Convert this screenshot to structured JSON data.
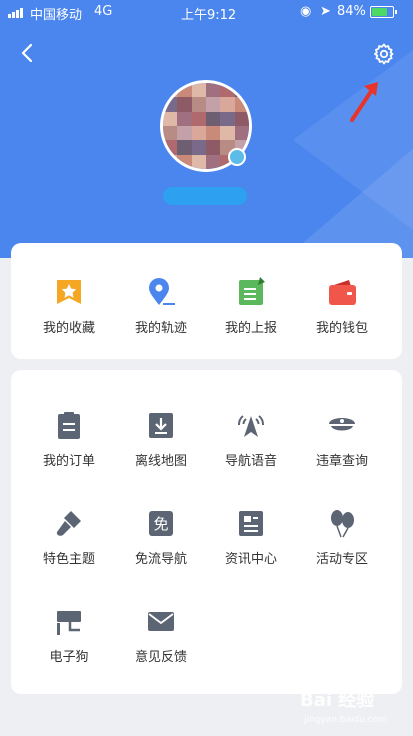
{
  "status_bar": {
    "carrier": "中国移动",
    "network": "4G",
    "time": "上午9:12",
    "battery": "84%",
    "battery_level": 0.84
  },
  "header": {
    "back_icon": "chevron-left-icon",
    "settings_icon": "gear-icon",
    "annotation_icon": "red-arrow-icon"
  },
  "profile": {
    "avatar": "pixelated-avatar",
    "name": ""
  },
  "quick_links": [
    {
      "label": "我的收藏",
      "icon": "star-icon",
      "color": "#f5a623"
    },
    {
      "label": "我的轨迹",
      "icon": "location-pin-icon",
      "color": "#4b86ee"
    },
    {
      "label": "我的上报",
      "icon": "report-icon",
      "color": "#5cb85c"
    },
    {
      "label": "我的钱包",
      "icon": "wallet-icon",
      "color": "#f0564a"
    }
  ],
  "services": [
    {
      "label": "我的订单",
      "icon": "clipboard-icon"
    },
    {
      "label": "离线地图",
      "icon": "download-icon"
    },
    {
      "label": "导航语音",
      "icon": "voice-navigation-icon"
    },
    {
      "label": "违章查询",
      "icon": "police-cap-icon"
    },
    {
      "label": "特色主题",
      "icon": "paint-brush-icon"
    },
    {
      "label": "免流导航",
      "icon": "free-badge-icon",
      "badge_text": "免"
    },
    {
      "label": "资讯中心",
      "icon": "news-icon"
    },
    {
      "label": "活动专区",
      "icon": "balloons-icon"
    },
    {
      "label": "电子狗",
      "icon": "camera-icon"
    },
    {
      "label": "意见反馈",
      "icon": "envelope-icon"
    }
  ],
  "watermark": {
    "text": "Bai 经验"
  }
}
